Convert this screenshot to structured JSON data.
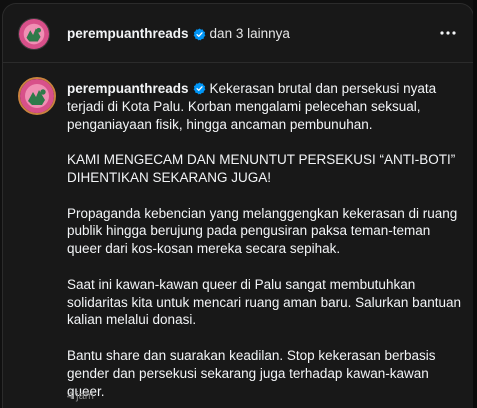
{
  "header": {
    "username": "perempuanthreads",
    "others": "dan 3 lainnya",
    "more_icon": "ellipsis-icon"
  },
  "post": {
    "username": "perempuanthreads",
    "paragraphs": [
      "Kekerasan brutal dan persekusi nyata terjadi di Kota Palu. Korban mengalami pelecehan seksual, penganiayaan fisik, hingga ancaman pembunuhan.",
      "KAMI MENGECAM DAN MENUNTUT PERSEKUSI “ANTI-BOTI” DIHENTIKAN SEKARANG JUGA!",
      "Propaganda kebencian yang melanggengkan kekerasan di ruang publik hingga berujung pada pengusiran paksa teman-teman queer dari kos-kosan mereka secara sepihak.",
      "Saat ini kawan-kawan queer di Palu sangat membutuhkan solidaritas kita untuk mencari ruang aman baru. Salurkan bantuan kalian melalui donasi.",
      "Bantu share dan suarakan keadilan. Stop kekerasan berbasis gender dan persekusi sekarang juga terhadap kawan-kawan queer."
    ],
    "timestamp": "4 jam"
  },
  "colors": {
    "background": "#181818",
    "text": "#f3f5f7",
    "muted": "#8a8a8a",
    "verified": "#0095f6",
    "avatar_bg": "#d8508a"
  }
}
